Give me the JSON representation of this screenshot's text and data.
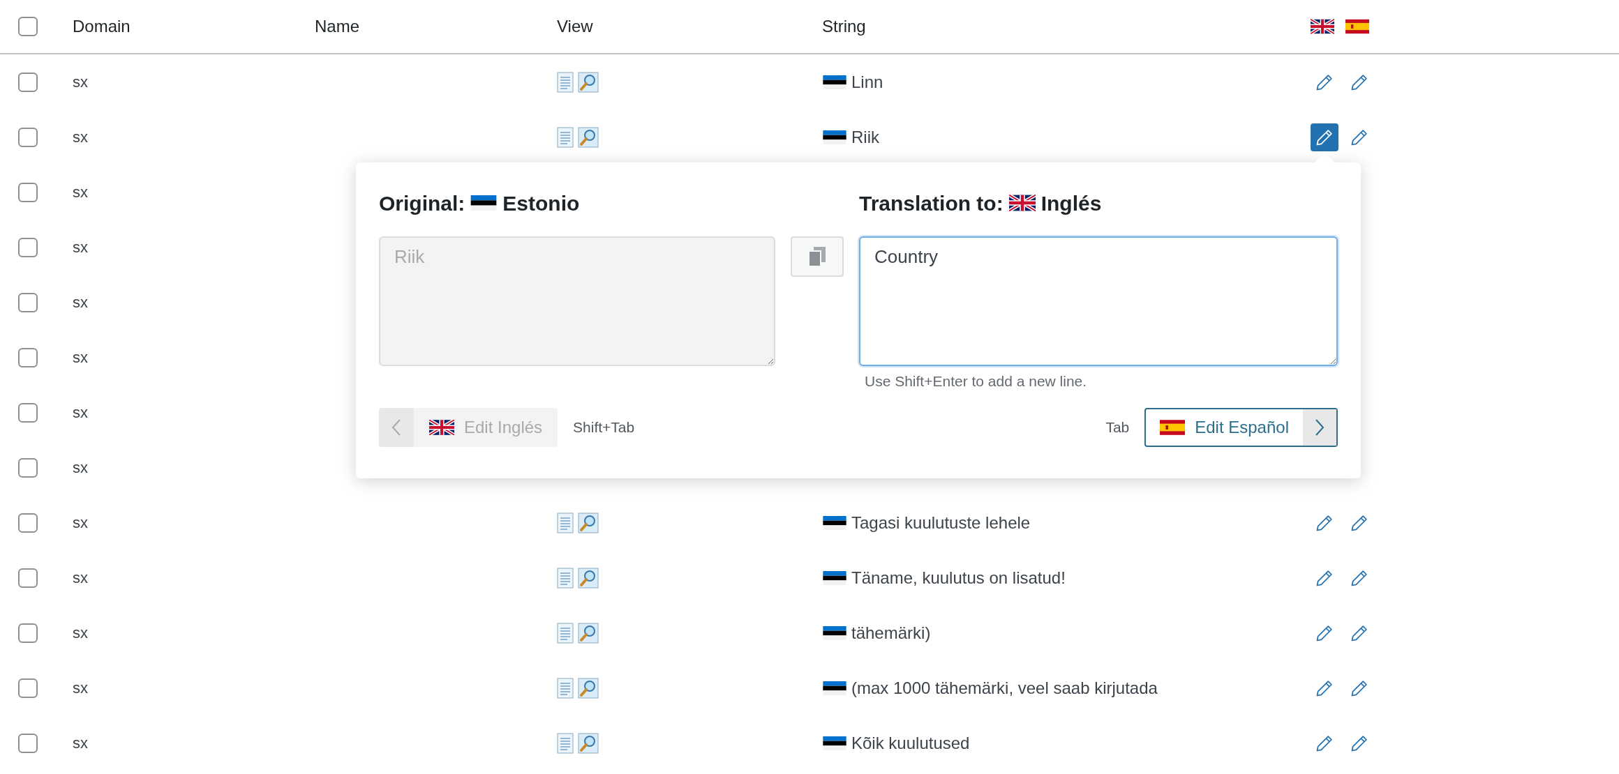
{
  "table": {
    "columns": [
      "Domain",
      "Name",
      "View",
      "String"
    ],
    "header_flags": [
      {
        "kind": "gb"
      },
      {
        "kind": "es"
      }
    ],
    "select_all_checked": false,
    "rows": [
      {
        "checked": false,
        "domain": "sx",
        "string": "Linn",
        "flag": {
          "kind": "ee"
        },
        "edit_buttons": [
          {
            "selected": false
          },
          {
            "selected": false
          }
        ]
      },
      {
        "checked": false,
        "domain": "sx",
        "string": "Riik",
        "flag": {
          "kind": "ee"
        },
        "edit_buttons": [
          {
            "selected": true
          },
          {
            "selected": false
          }
        ]
      },
      {
        "checked": false,
        "domain": "sx"
      },
      {
        "checked": false,
        "domain": "sx"
      },
      {
        "checked": false,
        "domain": "sx"
      },
      {
        "checked": false,
        "domain": "sx"
      },
      {
        "checked": false,
        "domain": "sx"
      },
      {
        "checked": false,
        "domain": "sx"
      },
      {
        "checked": false,
        "domain": "sx",
        "string": "Tagasi kuulutuste lehele",
        "flag": {
          "kind": "ee"
        },
        "edit_buttons": [
          {
            "selected": false
          },
          {
            "selected": false
          }
        ]
      },
      {
        "checked": false,
        "domain": "sx",
        "string": "Täname, kuulutus on lisatud!",
        "flag": {
          "kind": "ee"
        },
        "edit_buttons": [
          {
            "selected": false
          },
          {
            "selected": false
          }
        ]
      },
      {
        "checked": false,
        "domain": "sx",
        "string": "tähemärki)",
        "flag": {
          "kind": "ee"
        },
        "edit_buttons": [
          {
            "selected": false
          },
          {
            "selected": false
          }
        ]
      },
      {
        "checked": false,
        "domain": "sx",
        "string": "(max 1000 tähemärki, veel saab kirjutada",
        "flag": {
          "kind": "ee"
        },
        "edit_buttons": [
          {
            "selected": false
          },
          {
            "selected": false
          }
        ]
      },
      {
        "checked": false,
        "domain": "sx",
        "string": "Kõik kuulutused",
        "flag": {
          "kind": "ee"
        },
        "edit_buttons": [
          {
            "selected": false
          },
          {
            "selected": false
          }
        ]
      }
    ]
  },
  "popup": {
    "original_label": "Original:",
    "original_flag": {
      "kind": "ee"
    },
    "original_language": "Estonio",
    "original_value": "Riik",
    "translation_label": "Translation to:",
    "translation_flag": {
      "kind": "gb"
    },
    "translation_language": "Inglés",
    "translation_value": "Country",
    "hint": "Use Shift+Enter to add a new line.",
    "prev": {
      "flag": {
        "kind": "gb"
      },
      "label": "Edit Inglés",
      "disabled": true
    },
    "prev_shortcut": "Shift+Tab",
    "next_shortcut": "Tab",
    "next": {
      "flag": {
        "kind": "es"
      },
      "label": "Edit Español",
      "disabled": false
    }
  }
}
